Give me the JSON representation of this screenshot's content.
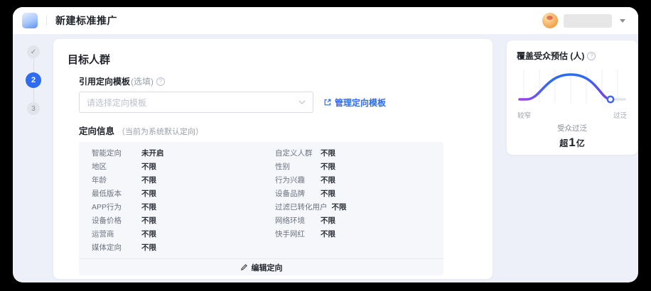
{
  "header": {
    "title": "新建标准推广"
  },
  "stepper": {
    "step2_label": "2",
    "step3_label": "3"
  },
  "audience_section": {
    "title": "目标人群",
    "template_field": {
      "label": "引用定向模板",
      "optional_hint": "(选填)",
      "placeholder": "请选择定向模板",
      "manage_link_label": "管理定向模板"
    },
    "targeting_info": {
      "label": "定向信息",
      "note": "（当前为系统默认定向）",
      "left_rows": [
        {
          "label": "智能定向",
          "value": "未开启"
        },
        {
          "label": "地区",
          "value": "不限"
        },
        {
          "label": "年龄",
          "value": "不限"
        },
        {
          "label": "最低版本",
          "value": "不限"
        },
        {
          "label": "APP行为",
          "value": "不限"
        },
        {
          "label": "设备价格",
          "value": "不限"
        },
        {
          "label": "运营商",
          "value": "不限"
        },
        {
          "label": "媒体定向",
          "value": "不限"
        }
      ],
      "right_rows": [
        {
          "label": "自定义人群",
          "value": "不限"
        },
        {
          "label": "性别",
          "value": "不限"
        },
        {
          "label": "行为兴趣",
          "value": "不限"
        },
        {
          "label": "设备品牌",
          "value": "不限"
        },
        {
          "label": "过滤已转化用户",
          "value": "不限"
        },
        {
          "label": "网络环境",
          "value": "不限"
        },
        {
          "label": "快手网红",
          "value": "不限"
        }
      ],
      "edit_button_label": "编辑定向"
    }
  },
  "estimate_panel": {
    "title": "覆盖受众预估 (人)",
    "chart_data": {
      "type": "area",
      "description": "bell curve of audience breadth, marker at far right end",
      "x_left_label": "较窄",
      "x_right_label": "过泛",
      "status_label": "受众过泛",
      "marker_position": "right-end",
      "color_start": "#b13ae6",
      "color_mid": "#2e6bf2",
      "color_end": "#8a35e8",
      "marker_color": "#3f66f0",
      "rest_color": "#e2e5ec"
    },
    "value": {
      "prefix": "超",
      "number": "1",
      "unit": "亿"
    }
  },
  "colors": {
    "primary_blue": "#2e6bf0",
    "app_bg": "#edf0f8",
    "table_bg": "#f6f7fa"
  }
}
